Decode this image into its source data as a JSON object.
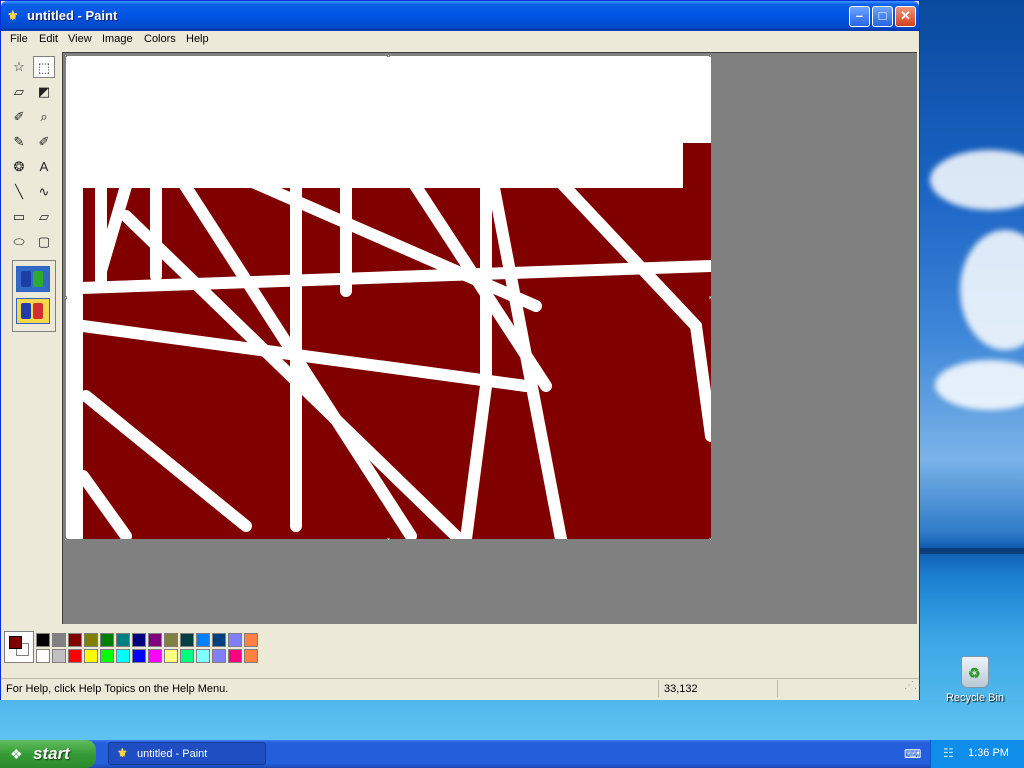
{
  "window": {
    "title": "untitled - Paint",
    "minimize_glyph": "–",
    "maximize_glyph": "□",
    "close_glyph": "✕"
  },
  "menu": [
    "File",
    "Edit",
    "View",
    "Image",
    "Colors",
    "Help"
  ],
  "tools": [
    {
      "name": "free-form-select-tool",
      "glyph": "☆"
    },
    {
      "name": "select-tool",
      "glyph": "⬚",
      "selected": true
    },
    {
      "name": "eraser-tool",
      "glyph": "▱"
    },
    {
      "name": "fill-tool",
      "glyph": "◩"
    },
    {
      "name": "pick-color-tool",
      "glyph": "✐"
    },
    {
      "name": "magnifier-tool",
      "glyph": "⌕"
    },
    {
      "name": "pencil-tool",
      "glyph": "✎"
    },
    {
      "name": "brush-tool",
      "glyph": "✐"
    },
    {
      "name": "airbrush-tool",
      "glyph": "❂"
    },
    {
      "name": "text-tool",
      "glyph": "A"
    },
    {
      "name": "line-tool",
      "glyph": "╲"
    },
    {
      "name": "curve-tool",
      "glyph": "∿"
    },
    {
      "name": "rectangle-tool",
      "glyph": "▭"
    },
    {
      "name": "polygon-tool",
      "glyph": "▱"
    },
    {
      "name": "ellipse-tool",
      "glyph": "⬭"
    },
    {
      "name": "rounded-rectangle-tool",
      "glyph": "▢"
    }
  ],
  "colors": {
    "foreground": "#800000",
    "background": "#ffffff",
    "palette_top": [
      "#000000",
      "#808080",
      "#800000",
      "#808000",
      "#008000",
      "#008080",
      "#000080",
      "#800080",
      "#808040",
      "#004040",
      "#0080ff",
      "#004080",
      "#8080ff",
      "#ff8040"
    ],
    "palette_bottom": [
      "#ffffff",
      "#c0c0c0",
      "#ff0000",
      "#ffff00",
      "#00ff00",
      "#00ffff",
      "#0000ff",
      "#ff00ff",
      "#ffff80",
      "#00ff80",
      "#80ffff",
      "#8080ff",
      "#ff0080",
      "#ff8040"
    ]
  },
  "status": {
    "help_text": "For Help, click Help Topics on the Help Menu.",
    "coordinates": "33,132"
  },
  "desktop": {
    "recycle_bin_label": "Recycle Bin"
  },
  "taskbar": {
    "start_label": "start",
    "task_label": "untitled - Paint",
    "clock": "1:36 PM"
  }
}
